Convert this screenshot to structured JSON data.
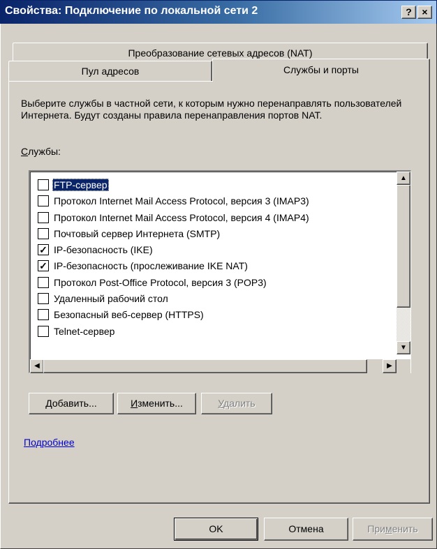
{
  "window": {
    "title": "Свойства: Подключение по локальной сети 2",
    "help_btn": "?",
    "close_btn": "×"
  },
  "tabs": {
    "nat": "Преобразование сетевых адресов (NAT)",
    "pool": "Пул адресов",
    "services": "Службы и порты"
  },
  "panel": {
    "description": "Выберите службы в частной сети, к которым нужно перенаправлять пользователей Интернета. Будут созданы правила перенаправления портов NAT.",
    "services_label_first": "С",
    "services_label_rest": "лужбы:",
    "services": [
      {
        "label": "FTP-сервер",
        "checked": false,
        "selected": true
      },
      {
        "label": "Протокол Internet Mail Access Protocol, версия 3 (IMAP3)",
        "checked": false
      },
      {
        "label": "Протокол Internet Mail Access Protocol, версия 4 (IMAP4)",
        "checked": false
      },
      {
        "label": "Почтовый сервер Интернета (SMTP)",
        "checked": false
      },
      {
        "label": "IP-безопасность (IKE)",
        "checked": true
      },
      {
        "label": "IP-безопасность (прослеживание IKE NAT)",
        "checked": true
      },
      {
        "label": "Протокол Post-Office Protocol, версия 3 (POP3)",
        "checked": false
      },
      {
        "label": "Удаленный рабочий стол",
        "checked": false
      },
      {
        "label": "Безопасный веб-сервер (HTTPS)",
        "checked": false
      },
      {
        "label": "Telnet-сервер",
        "checked": false
      }
    ],
    "add_button_first": "Д",
    "add_button_rest": "обавить...",
    "edit_button_first": "И",
    "edit_button_rest": "зменить...",
    "delete_button_first": "У",
    "delete_button_rest": "далить",
    "more_link": "Подробнее"
  },
  "footer": {
    "ok": "OK",
    "cancel": "Отмена",
    "apply_pre": "При",
    "apply_ul": "м",
    "apply_post": "енить"
  },
  "scrollbar": {
    "up": "▲",
    "down": "▼",
    "left": "◀",
    "right": "▶"
  }
}
